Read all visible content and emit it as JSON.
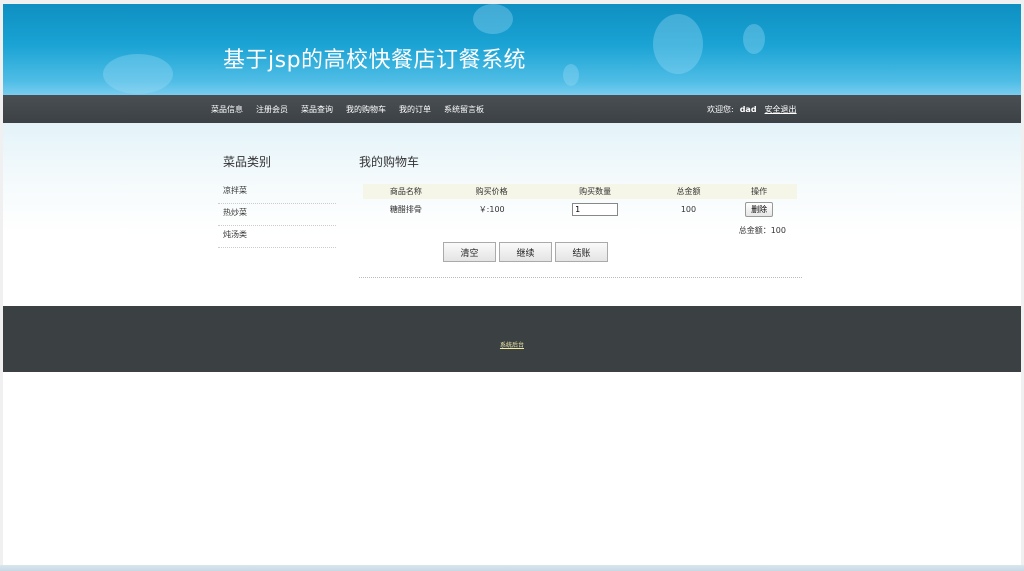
{
  "header": {
    "site_title": "基于jsp的高校快餐店订餐系统"
  },
  "nav": {
    "items": [
      {
        "label": "菜品信息"
      },
      {
        "label": "注册会员"
      },
      {
        "label": "菜品查询"
      },
      {
        "label": "我的购物车"
      },
      {
        "label": "我的订单"
      },
      {
        "label": "系统留言板"
      }
    ],
    "welcome_label": "欢迎您:",
    "username": "dad",
    "logout_label": "安全退出"
  },
  "sidebar": {
    "title": "菜品类别",
    "items": [
      {
        "label": "凉拌菜"
      },
      {
        "label": "热炒菜"
      },
      {
        "label": "炖汤类"
      }
    ]
  },
  "cart": {
    "title": "我的购物车",
    "columns": [
      "商品名称",
      "购买价格",
      "购买数量",
      "总金额",
      "操作"
    ],
    "rows": [
      {
        "name": "糖醋排骨",
        "price": "￥:100",
        "quantity": "1",
        "subtotal": "100",
        "action": "删除"
      }
    ],
    "total_text": "总金额：100",
    "buttons": {
      "clear": "清空",
      "continue": "继续",
      "checkout": "结账"
    }
  },
  "footer": {
    "link_label": "系统后台"
  },
  "colors": {
    "banner": "#1aa3d4",
    "navbar": "#43484c",
    "footer": "#3b4143",
    "footer_link": "#f2e9a6",
    "table_header": "#f6f6e8"
  }
}
